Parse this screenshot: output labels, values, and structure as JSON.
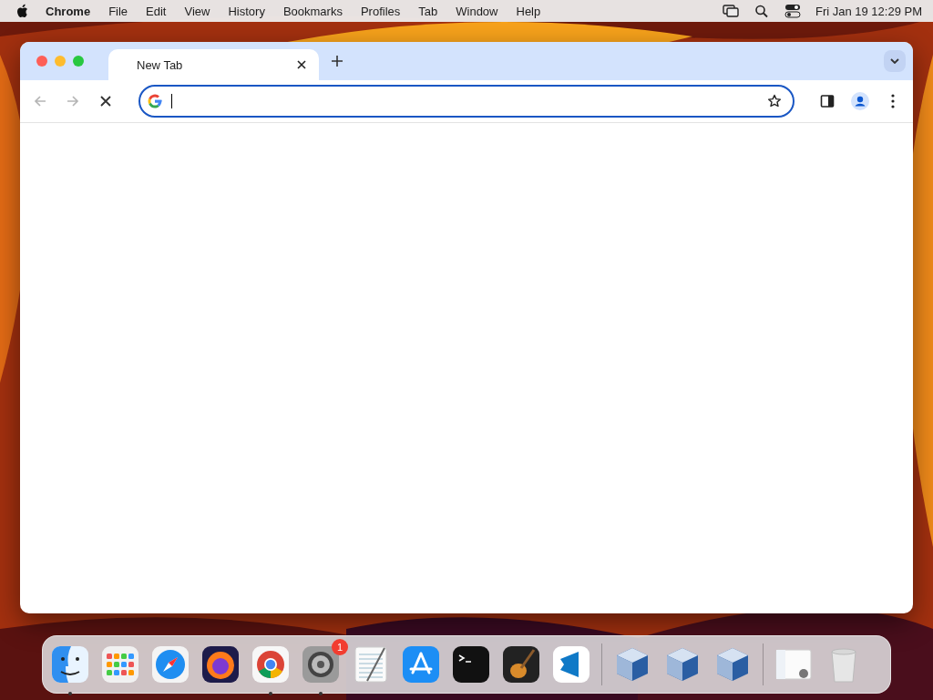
{
  "menu_bar": {
    "app_name": "Chrome",
    "menus": [
      "File",
      "Edit",
      "View",
      "History",
      "Bookmarks",
      "Profiles",
      "Tab",
      "Window",
      "Help"
    ],
    "clock": "Fri Jan 19 12:29 PM"
  },
  "browser": {
    "tabs": [
      {
        "label": "New Tab",
        "selected": true
      }
    ],
    "toolbar": {
      "back_disabled": true,
      "forward_disabled": true,
      "loading": true,
      "address_focused": true
    }
  },
  "dock": {
    "items": [
      {
        "kind": "finder",
        "running": true
      },
      {
        "kind": "launchpad"
      },
      {
        "kind": "safari"
      },
      {
        "kind": "firefox"
      },
      {
        "kind": "chrome",
        "running": true
      },
      {
        "kind": "settings",
        "running": true,
        "badge": "1"
      },
      {
        "kind": "textedit"
      },
      {
        "kind": "appstore"
      },
      {
        "kind": "terminal"
      },
      {
        "kind": "garageband"
      },
      {
        "kind": "vscode"
      },
      {
        "kind": "separator"
      },
      {
        "kind": "virtualbox"
      },
      {
        "kind": "virtualbox"
      },
      {
        "kind": "virtualbox"
      },
      {
        "kind": "separator"
      },
      {
        "kind": "preview"
      },
      {
        "kind": "trash"
      }
    ]
  }
}
